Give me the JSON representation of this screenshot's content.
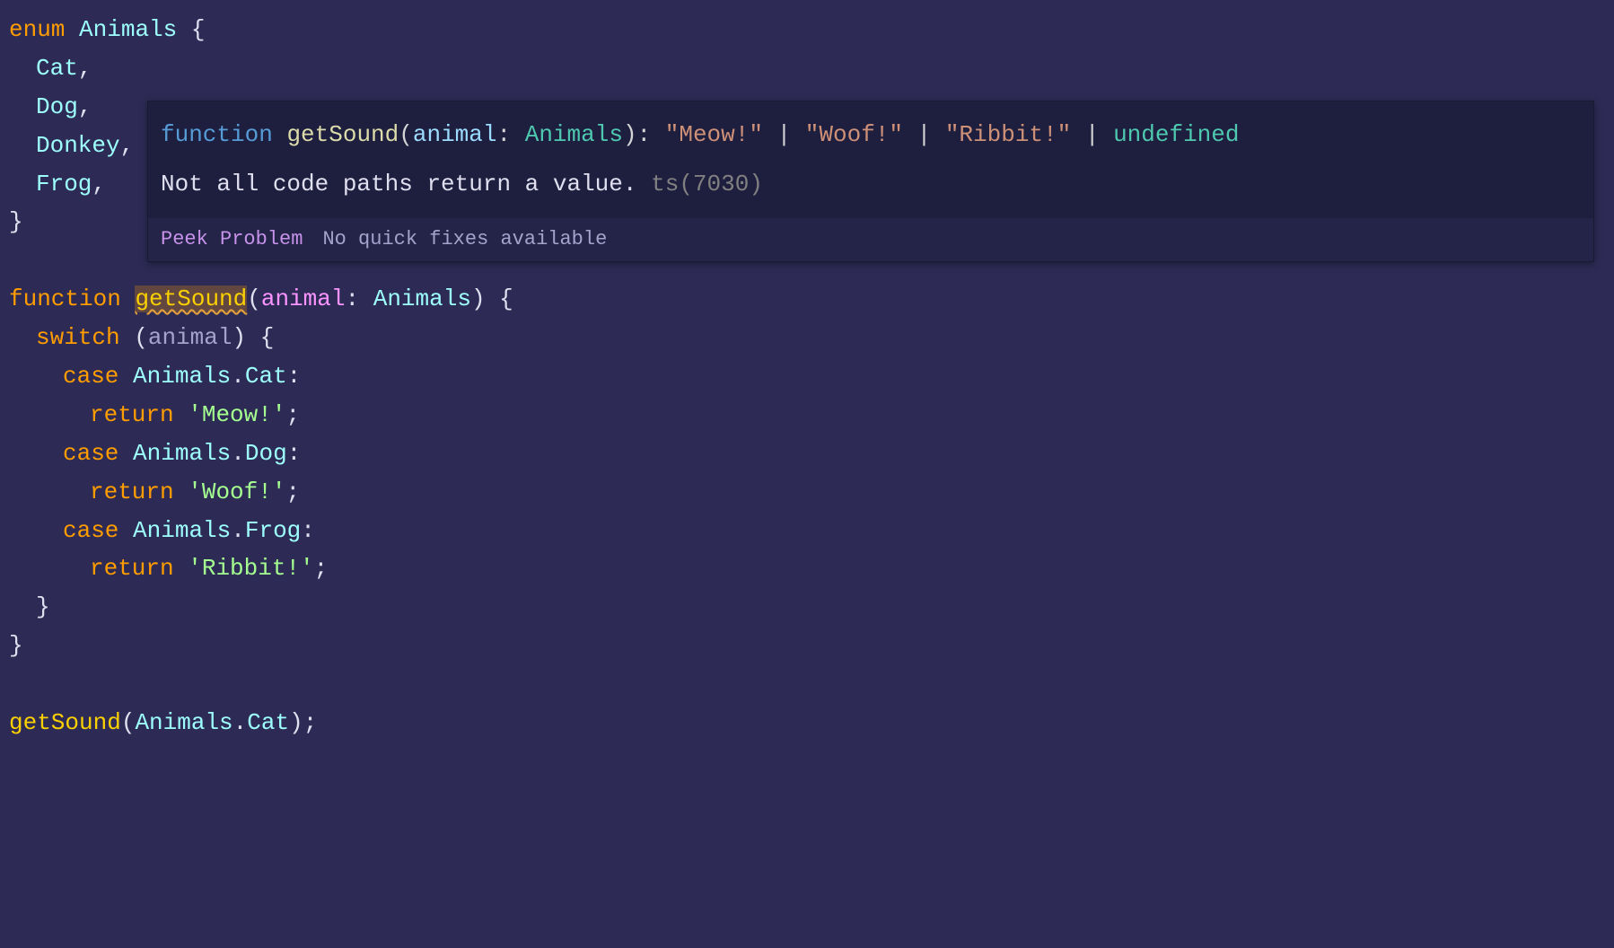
{
  "code": {
    "enum_kwd": "enum",
    "enum_name": "Animals",
    "enum_members": [
      "Cat",
      "Dog",
      "Donkey",
      "Frog"
    ],
    "function_kwd": "function",
    "func_name": "getSound",
    "param_name": "animal",
    "param_type": "Animals",
    "switch_kwd": "switch",
    "case_kwd": "case",
    "return_kwd": "return",
    "cases": [
      {
        "enum": "Animals",
        "member": "Cat",
        "value": "'Meow!'"
      },
      {
        "enum": "Animals",
        "member": "Dog",
        "value": "'Woof!'"
      },
      {
        "enum": "Animals",
        "member": "Frog",
        "value": "'Ribbit!'"
      }
    ],
    "call_func": "getSound",
    "call_enum": "Animals",
    "call_member": "Cat"
  },
  "tooltip": {
    "sig_function_kwd": "function",
    "sig_func_name": "getSound",
    "sig_param_name": "animal",
    "sig_param_type": "Animals",
    "sig_return": "\"Meow!\" | \"Woof!\" | \"Ribbit!\" | undefined",
    "sig_ret1": "\"Meow!\"",
    "sig_ret2": "\"Woof!\"",
    "sig_ret3": "\"Ribbit!\"",
    "sig_undef": "undefined",
    "error_message": "Not all code paths return a value.",
    "error_code": "ts(7030)",
    "peek_label": "Peek Problem",
    "quickfix_label": "No quick fixes available"
  }
}
